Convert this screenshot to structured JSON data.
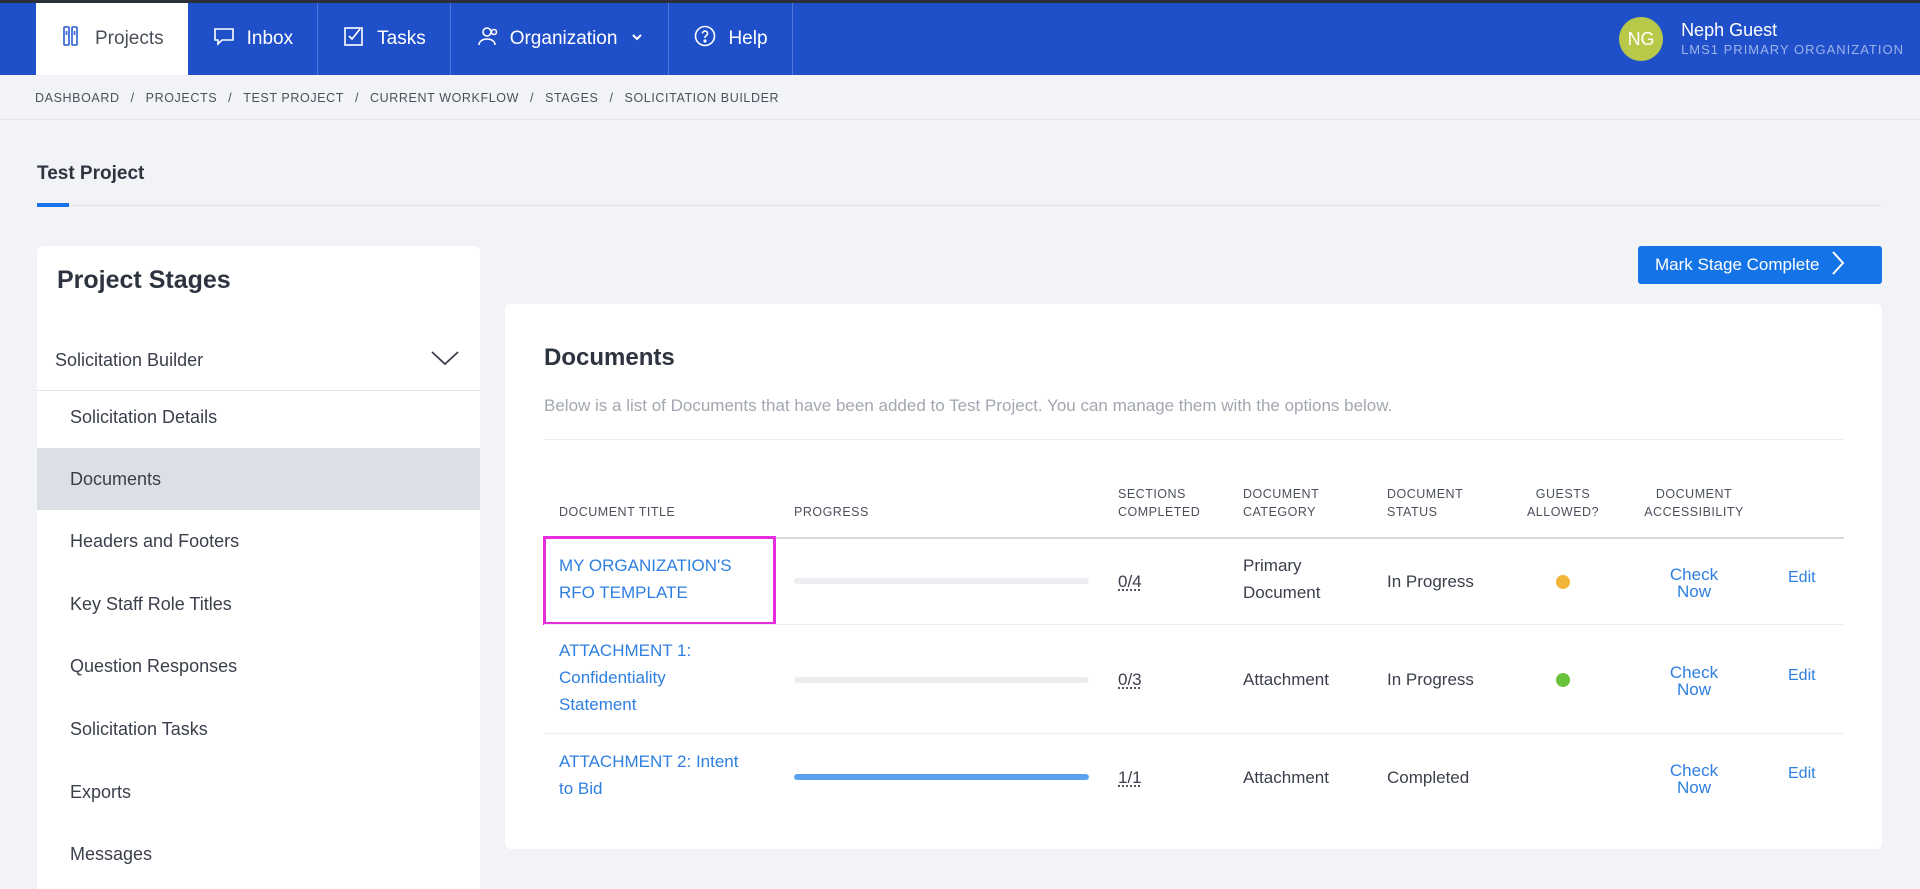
{
  "nav": {
    "items": [
      {
        "label": "Projects",
        "icon": "projects-icon",
        "active": true
      },
      {
        "label": "Inbox",
        "icon": "inbox-icon"
      },
      {
        "label": "Tasks",
        "icon": "tasks-icon"
      },
      {
        "label": "Organization",
        "icon": "organization-icon",
        "has_dropdown": true
      },
      {
        "label": "Help",
        "icon": "help-icon"
      }
    ]
  },
  "user": {
    "initials": "NG",
    "name": "Neph Guest",
    "org": "LMS1 PRIMARY ORGANIZATION",
    "avatar_color": "#b8c94a"
  },
  "breadcrumb": [
    "DASHBOARD",
    "PROJECTS",
    "TEST PROJECT",
    "CURRENT WORKFLOW",
    "STAGES",
    "SOLICITATION BUILDER"
  ],
  "page": {
    "title": "Test Project"
  },
  "stages": {
    "title": "Project Stages",
    "selected_stage": "Solicitation Builder",
    "items": [
      {
        "label": "Solicitation Details"
      },
      {
        "label": "Documents",
        "active": true
      },
      {
        "label": "Headers and Footers"
      },
      {
        "label": "Key Staff Role Titles"
      },
      {
        "label": "Question Responses"
      },
      {
        "label": "Solicitation Tasks"
      },
      {
        "label": "Exports"
      },
      {
        "label": "Messages"
      }
    ]
  },
  "actions": {
    "mark_complete_label": "Mark Stage Complete"
  },
  "documents": {
    "title": "Documents",
    "description": "Below is a list of Documents that have been added to Test Project. You can manage them with the options below.",
    "columns": {
      "title": "DOCUMENT TITLE",
      "progress": "PROGRESS",
      "sections_1": "SECTIONS",
      "sections_2": "COMPLETED",
      "category_1": "DOCUMENT",
      "category_2": "CATEGORY",
      "status_1": "DOCUMENT",
      "status_2": "STATUS",
      "guests_1": "GUESTS",
      "guests_2": "ALLOWED?",
      "access_1": "DOCUMENT",
      "access_2": "ACCESSIBILITY"
    },
    "rows": [
      {
        "title_lines": [
          "MY ORGANIZATION'S",
          "RFO TEMPLATE"
        ],
        "progress": 0,
        "sections": "0/4",
        "category_lines": [
          "Primary",
          "Document"
        ],
        "status": "In Progress",
        "guest_dot_color": "#f2b53a",
        "check_label_lines": [
          "Check",
          "Now"
        ],
        "edit_label": "Edit"
      },
      {
        "title_lines": [
          "ATTACHMENT 1:",
          "Confidentiality",
          "Statement"
        ],
        "progress": 0,
        "sections": "0/3",
        "category_lines": [
          "Attachment"
        ],
        "status": "In Progress",
        "guest_dot_color": "#6ac23a",
        "check_label_lines": [
          "Check",
          "Now"
        ],
        "edit_label": "Edit"
      },
      {
        "title_lines": [
          "ATTACHMENT 2: Intent",
          "to Bid"
        ],
        "progress": 1.0,
        "sections": "1/1",
        "category_lines": [
          "Attachment"
        ],
        "status": "Completed",
        "guest_dot_color": null,
        "check_label_lines": [
          "Check",
          "Now"
        ],
        "edit_label": "Edit"
      }
    ]
  },
  "colors": {
    "nav_bg": "#1f4fc9",
    "accent": "#1473e6",
    "link": "#2e7fe0",
    "highlight": "#e62ee0"
  }
}
